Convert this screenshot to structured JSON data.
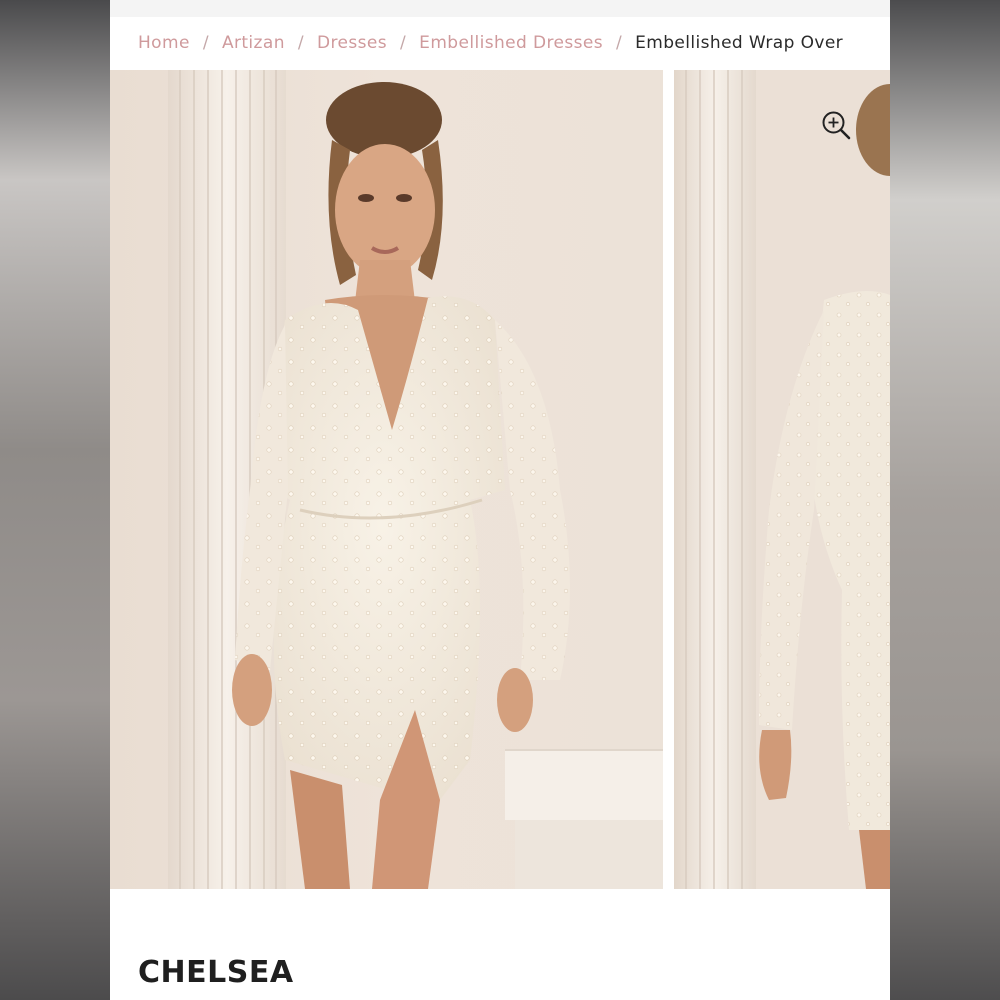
{
  "breadcrumb": {
    "items": [
      {
        "label": "Home"
      },
      {
        "label": "Artizan"
      },
      {
        "label": "Dresses"
      },
      {
        "label": "Embellished Dresses"
      }
    ],
    "current": "Embellished Wrap Over",
    "separator": "/"
  },
  "gallery": {
    "zoom_icon": "zoom-in-icon",
    "images": [
      {
        "alt": "Model wearing embellished wrap over mini dress, front view"
      },
      {
        "alt": "Model wearing embellished wrap over mini dress, side view"
      }
    ]
  },
  "product": {
    "title": "CHELSEA"
  },
  "colors": {
    "breadcrumb_link": "#cf9a9c",
    "breadcrumb_current": "#2b2b2b",
    "dress": "#f3ece0",
    "backdrop": "#ece1d6"
  }
}
